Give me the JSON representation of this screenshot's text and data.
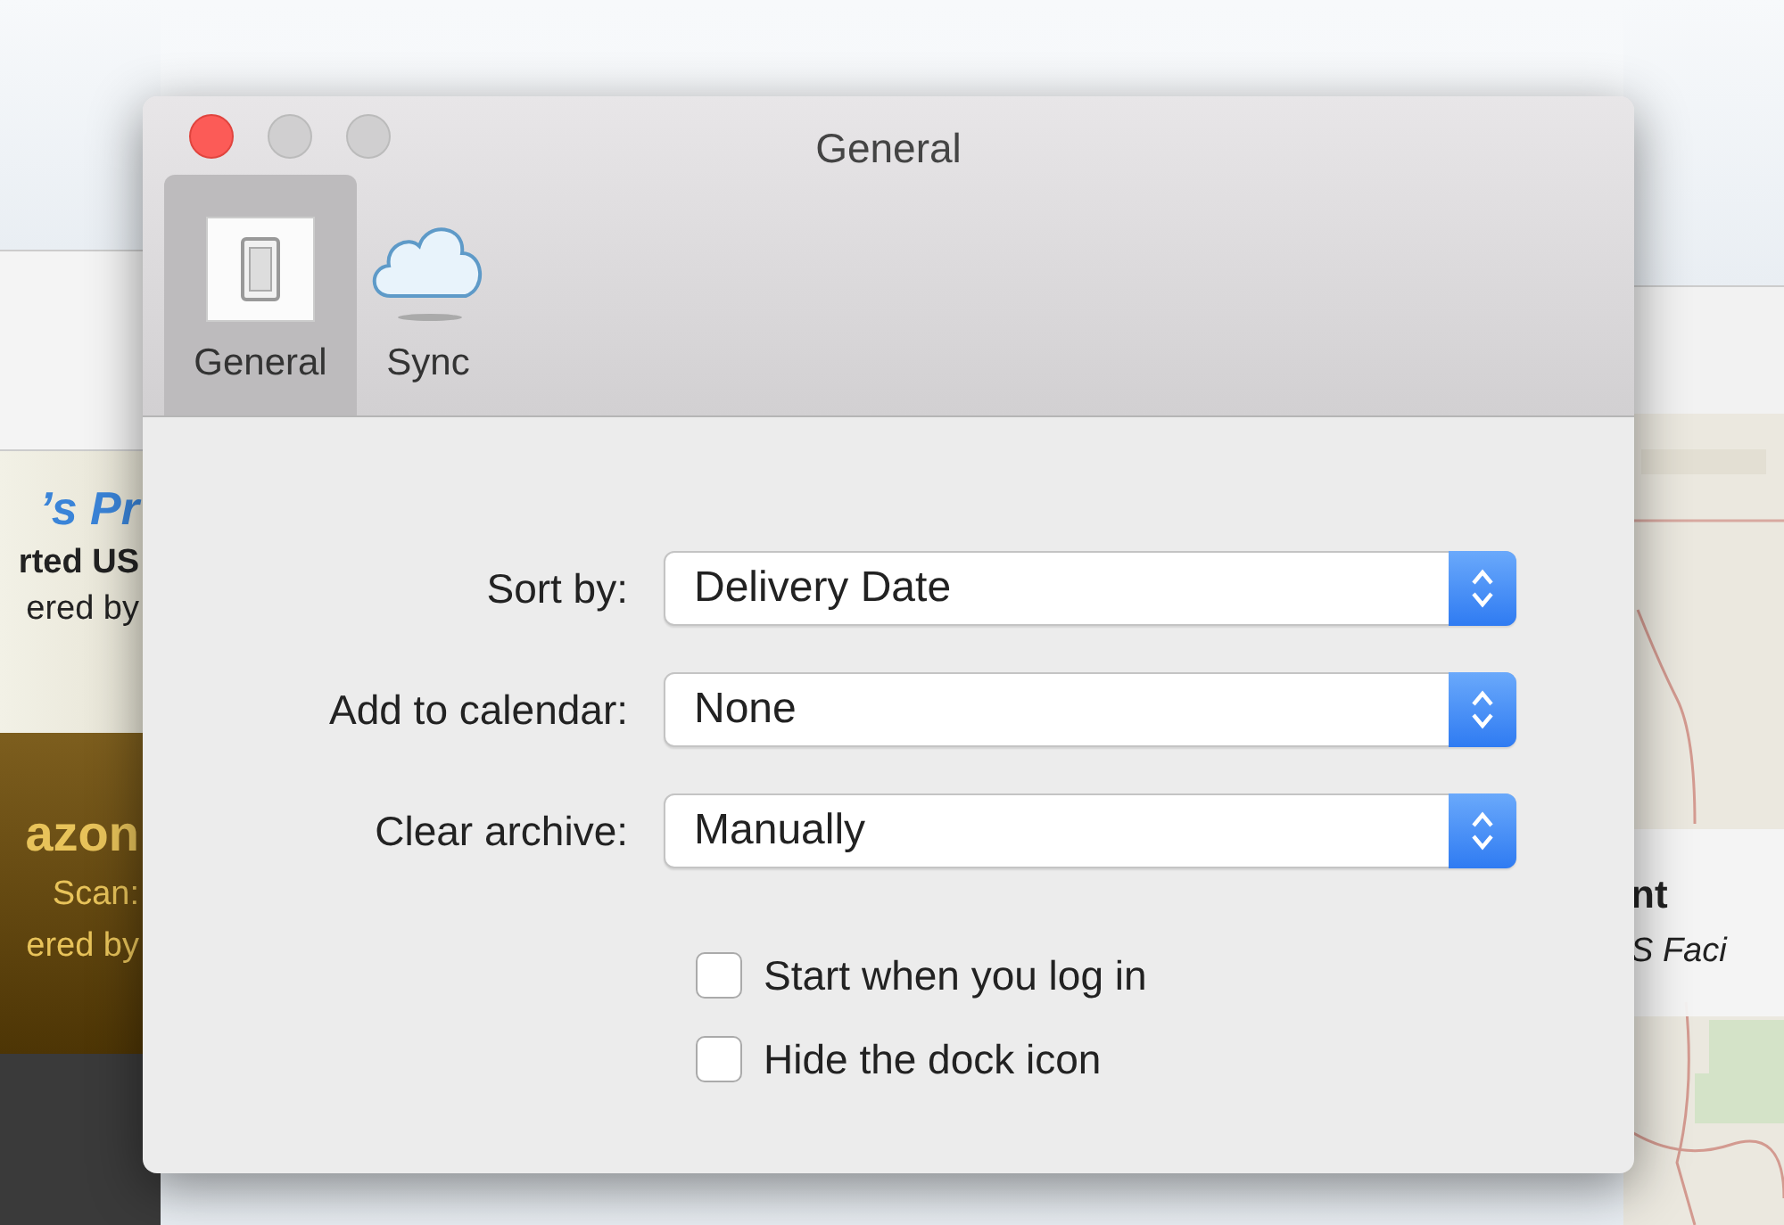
{
  "background_left": [
    {
      "text": "’s Pr",
      "kind": "heading"
    },
    {
      "text": "rted US",
      "kind": "strong"
    },
    {
      "text": "ered by",
      "kind": "plain"
    },
    {
      "text": "azon",
      "kind": "promo-heading"
    },
    {
      "text": "Scan:",
      "kind": "promo"
    },
    {
      "text": "ered by",
      "kind": "promo"
    }
  ],
  "background_right": {
    "card": [
      {
        "text": "nt",
        "kind": "strong"
      },
      {
        "text": "S Faci",
        "kind": "italic"
      }
    ]
  },
  "window": {
    "title": "General"
  },
  "toolbar": [
    {
      "label": "General",
      "kind": "general",
      "selected": true
    },
    {
      "label": "Sync",
      "kind": "sync",
      "selected": false
    }
  ],
  "selects": [
    {
      "label": "Sort by:",
      "value": "Delivery Date"
    },
    {
      "label": "Add to calendar:",
      "value": "None"
    },
    {
      "label": "Clear archive:",
      "value": "Manually"
    }
  ],
  "checkboxes": [
    {
      "label": "Start when you log in",
      "checked": false
    },
    {
      "label": "Hide the dock icon",
      "checked": false
    }
  ]
}
